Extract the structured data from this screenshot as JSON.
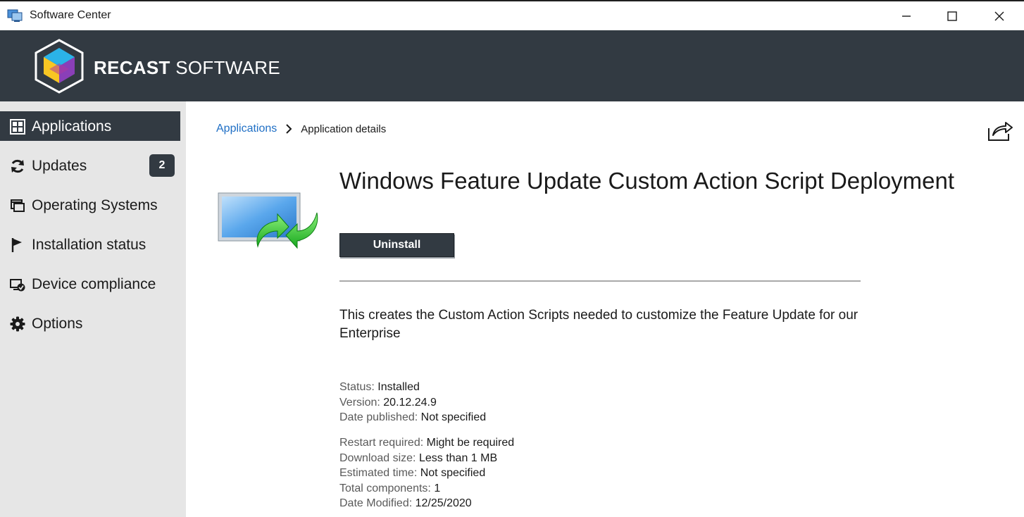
{
  "window": {
    "title": "Software Center"
  },
  "banner": {
    "brand_bold": "RECAST",
    "brand_rest": "SOFTWARE"
  },
  "sidebar": {
    "items": [
      {
        "label": "Applications",
        "icon": "applications-icon",
        "active": true
      },
      {
        "label": "Updates",
        "icon": "refresh-icon",
        "badge": "2"
      },
      {
        "label": "Operating Systems",
        "icon": "windows-icon"
      },
      {
        "label": "Installation status",
        "icon": "flag-icon"
      },
      {
        "label": "Device compliance",
        "icon": "device-compliance-icon"
      },
      {
        "label": "Options",
        "icon": "gear-icon"
      }
    ]
  },
  "breadcrumb": {
    "parent": "Applications",
    "current": "Application details"
  },
  "app": {
    "title": "Windows Feature Update Custom Action Script Deployment",
    "action_label": "Uninstall",
    "description": "This creates the Custom Action Scripts needed to customize the Feature Update for our Enterprise",
    "properties_primary": [
      {
        "key": "Status:",
        "value": "Installed"
      },
      {
        "key": "Version:",
        "value": "20.12.24.9"
      },
      {
        "key": "Date published:",
        "value": "Not specified"
      }
    ],
    "properties_secondary": [
      {
        "key": "Restart required:",
        "value": "Might be required"
      },
      {
        "key": "Download size:",
        "value": "Less than 1 MB"
      },
      {
        "key": "Estimated time:",
        "value": "Not specified"
      },
      {
        "key": "Total components:",
        "value": "1"
      },
      {
        "key": "Date Modified:",
        "value": "12/25/2020"
      }
    ]
  },
  "colors": {
    "banner": "#323a42",
    "sidebar": "#e6e6e6",
    "link": "#1f6fc5"
  }
}
